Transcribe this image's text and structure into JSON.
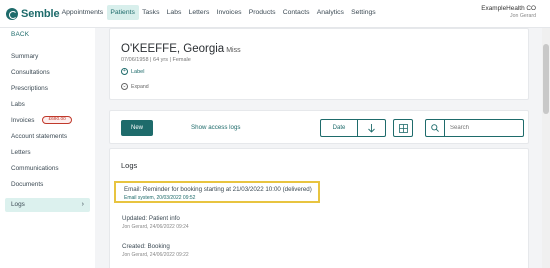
{
  "brand": {
    "name": "Semble"
  },
  "nav": {
    "items": [
      "Appointments",
      "Patients",
      "Tasks",
      "Labs",
      "Letters",
      "Invoices",
      "Products",
      "Contacts",
      "Analytics",
      "Settings"
    ],
    "active": "Patients"
  },
  "org": {
    "name": "ExampleHealth CO",
    "user": "Jon Gerard"
  },
  "sidebar": {
    "back": "BACK",
    "items": [
      {
        "label": "Summary"
      },
      {
        "label": "Consultations"
      },
      {
        "label": "Prescriptions"
      },
      {
        "label": "Labs"
      },
      {
        "label": "Invoices",
        "badge": "£690.00"
      },
      {
        "label": "Account statements"
      },
      {
        "label": "Letters"
      },
      {
        "label": "Communications"
      },
      {
        "label": "Documents"
      },
      {
        "label": "Logs",
        "active": true
      }
    ]
  },
  "patient": {
    "name": "O'KEEFFE, Georgia",
    "title": "Miss",
    "meta": "07/06/1958  |  64 yrs  |  Female",
    "label_link": "Label",
    "expand_link": "Expand"
  },
  "toolbar": {
    "new_label": "New",
    "show_logs_label": "Show access logs",
    "date_label": "Date",
    "search_placeholder": "Search"
  },
  "logs": {
    "title": "Logs",
    "entries": [
      {
        "title": "Email: Reminder for booking starting at 21/03/2022 10:00 (delivered)",
        "sub": "Email system, 20/03/2022 09:52",
        "highlighted": true
      },
      {
        "title": "Updated: Patient info",
        "sub": "Jon Gerard, 24/06/2022 09:24"
      },
      {
        "title": "Created: Booking",
        "sub": "Jon Gerard, 24/06/2022 09:22"
      }
    ]
  },
  "colors": {
    "brand": "#1e6b6b",
    "highlight": "#e8c440",
    "badge": "#c0392b"
  }
}
